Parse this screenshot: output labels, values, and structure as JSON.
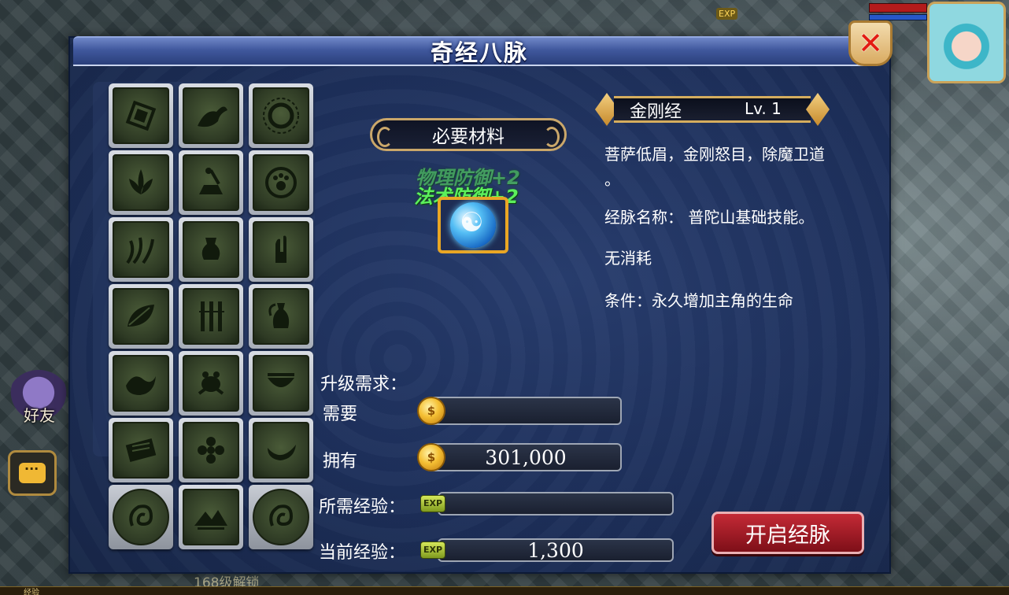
{
  "window": {
    "title": "奇经八脉",
    "close_icon": "close-icon"
  },
  "background": {
    "top_exp_badge": "EXP",
    "friend_label": "好友",
    "bottom_unlock_label": "168级解锁",
    "bottom_strip_label": "经验"
  },
  "grid": {
    "icons": [
      "diamond-sigil-icon",
      "bird-icon",
      "sun-ring-icon",
      "lotus-icon",
      "bell-hammer-icon",
      "paw-circle-icon",
      "tendril-icon",
      "urn-icon",
      "palm-hand-icon",
      "leaf-icon",
      "bamboo-icon",
      "vase-icon",
      "wave-icon",
      "frog-icon",
      "bowl-icon",
      "scroll-icon",
      "flower-icon",
      "crescent-icon",
      "coiled-dragon-icon",
      "mountain-icon",
      "coiled-dragon-icon"
    ]
  },
  "materials": {
    "title": "必要材料",
    "buffs": [
      "物理防御+2",
      "法术防御+2"
    ],
    "item_icon": "water-orb-icon"
  },
  "skill": {
    "name": "金刚经",
    "level": "Lv. 1",
    "description_line1": "菩萨低眉，金刚怒目，除魔卫道",
    "description_line2": "。",
    "meridian": "经脉名称：  普陀山基础技能。",
    "cost": "无消耗",
    "condition": "条件：永久增加主角的生命"
  },
  "upgrade": {
    "header": "升级需求：",
    "need_label": "需要",
    "need_value": "",
    "have_label": "拥有",
    "have_value": "301,000",
    "coin_glyph": "$",
    "req_exp_label": "所需经验：",
    "req_exp_value": "",
    "cur_exp_label": "当前经验：",
    "cur_exp_value": "1,300",
    "exp_badge": "EXP"
  },
  "action": {
    "open_button": "开启经脉"
  }
}
